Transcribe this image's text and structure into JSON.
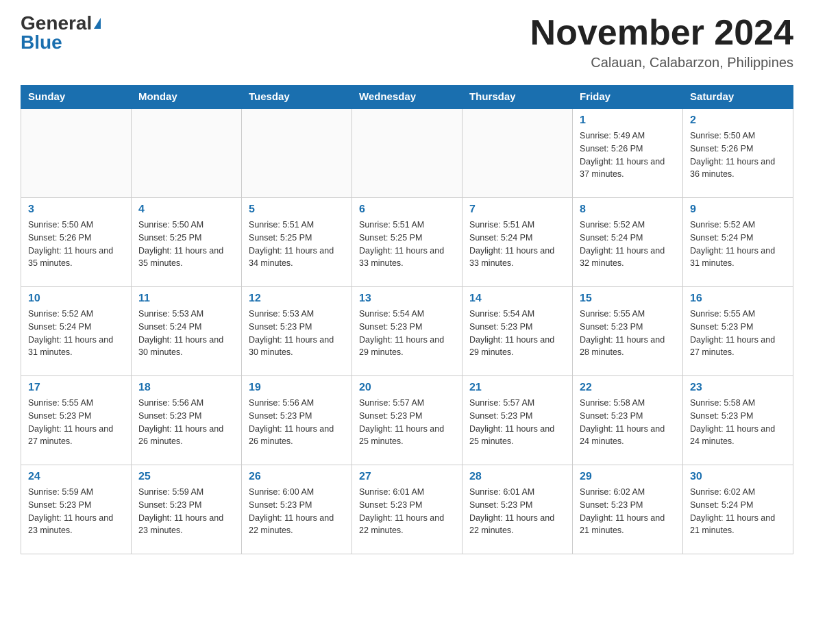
{
  "header": {
    "logo_general": "General",
    "logo_blue": "Blue",
    "month_year": "November 2024",
    "location": "Calauan, Calabarzon, Philippines"
  },
  "days_of_week": [
    "Sunday",
    "Monday",
    "Tuesday",
    "Wednesday",
    "Thursday",
    "Friday",
    "Saturday"
  ],
  "weeks": [
    {
      "days": [
        {
          "num": "",
          "info": ""
        },
        {
          "num": "",
          "info": ""
        },
        {
          "num": "",
          "info": ""
        },
        {
          "num": "",
          "info": ""
        },
        {
          "num": "",
          "info": ""
        },
        {
          "num": "1",
          "info": "Sunrise: 5:49 AM\nSunset: 5:26 PM\nDaylight: 11 hours and 37 minutes."
        },
        {
          "num": "2",
          "info": "Sunrise: 5:50 AM\nSunset: 5:26 PM\nDaylight: 11 hours and 36 minutes."
        }
      ]
    },
    {
      "days": [
        {
          "num": "3",
          "info": "Sunrise: 5:50 AM\nSunset: 5:26 PM\nDaylight: 11 hours and 35 minutes."
        },
        {
          "num": "4",
          "info": "Sunrise: 5:50 AM\nSunset: 5:25 PM\nDaylight: 11 hours and 35 minutes."
        },
        {
          "num": "5",
          "info": "Sunrise: 5:51 AM\nSunset: 5:25 PM\nDaylight: 11 hours and 34 minutes."
        },
        {
          "num": "6",
          "info": "Sunrise: 5:51 AM\nSunset: 5:25 PM\nDaylight: 11 hours and 33 minutes."
        },
        {
          "num": "7",
          "info": "Sunrise: 5:51 AM\nSunset: 5:24 PM\nDaylight: 11 hours and 33 minutes."
        },
        {
          "num": "8",
          "info": "Sunrise: 5:52 AM\nSunset: 5:24 PM\nDaylight: 11 hours and 32 minutes."
        },
        {
          "num": "9",
          "info": "Sunrise: 5:52 AM\nSunset: 5:24 PM\nDaylight: 11 hours and 31 minutes."
        }
      ]
    },
    {
      "days": [
        {
          "num": "10",
          "info": "Sunrise: 5:52 AM\nSunset: 5:24 PM\nDaylight: 11 hours and 31 minutes."
        },
        {
          "num": "11",
          "info": "Sunrise: 5:53 AM\nSunset: 5:24 PM\nDaylight: 11 hours and 30 minutes."
        },
        {
          "num": "12",
          "info": "Sunrise: 5:53 AM\nSunset: 5:23 PM\nDaylight: 11 hours and 30 minutes."
        },
        {
          "num": "13",
          "info": "Sunrise: 5:54 AM\nSunset: 5:23 PM\nDaylight: 11 hours and 29 minutes."
        },
        {
          "num": "14",
          "info": "Sunrise: 5:54 AM\nSunset: 5:23 PM\nDaylight: 11 hours and 29 minutes."
        },
        {
          "num": "15",
          "info": "Sunrise: 5:55 AM\nSunset: 5:23 PM\nDaylight: 11 hours and 28 minutes."
        },
        {
          "num": "16",
          "info": "Sunrise: 5:55 AM\nSunset: 5:23 PM\nDaylight: 11 hours and 27 minutes."
        }
      ]
    },
    {
      "days": [
        {
          "num": "17",
          "info": "Sunrise: 5:55 AM\nSunset: 5:23 PM\nDaylight: 11 hours and 27 minutes."
        },
        {
          "num": "18",
          "info": "Sunrise: 5:56 AM\nSunset: 5:23 PM\nDaylight: 11 hours and 26 minutes."
        },
        {
          "num": "19",
          "info": "Sunrise: 5:56 AM\nSunset: 5:23 PM\nDaylight: 11 hours and 26 minutes."
        },
        {
          "num": "20",
          "info": "Sunrise: 5:57 AM\nSunset: 5:23 PM\nDaylight: 11 hours and 25 minutes."
        },
        {
          "num": "21",
          "info": "Sunrise: 5:57 AM\nSunset: 5:23 PM\nDaylight: 11 hours and 25 minutes."
        },
        {
          "num": "22",
          "info": "Sunrise: 5:58 AM\nSunset: 5:23 PM\nDaylight: 11 hours and 24 minutes."
        },
        {
          "num": "23",
          "info": "Sunrise: 5:58 AM\nSunset: 5:23 PM\nDaylight: 11 hours and 24 minutes."
        }
      ]
    },
    {
      "days": [
        {
          "num": "24",
          "info": "Sunrise: 5:59 AM\nSunset: 5:23 PM\nDaylight: 11 hours and 23 minutes."
        },
        {
          "num": "25",
          "info": "Sunrise: 5:59 AM\nSunset: 5:23 PM\nDaylight: 11 hours and 23 minutes."
        },
        {
          "num": "26",
          "info": "Sunrise: 6:00 AM\nSunset: 5:23 PM\nDaylight: 11 hours and 22 minutes."
        },
        {
          "num": "27",
          "info": "Sunrise: 6:01 AM\nSunset: 5:23 PM\nDaylight: 11 hours and 22 minutes."
        },
        {
          "num": "28",
          "info": "Sunrise: 6:01 AM\nSunset: 5:23 PM\nDaylight: 11 hours and 22 minutes."
        },
        {
          "num": "29",
          "info": "Sunrise: 6:02 AM\nSunset: 5:23 PM\nDaylight: 11 hours and 21 minutes."
        },
        {
          "num": "30",
          "info": "Sunrise: 6:02 AM\nSunset: 5:24 PM\nDaylight: 11 hours and 21 minutes."
        }
      ]
    }
  ]
}
